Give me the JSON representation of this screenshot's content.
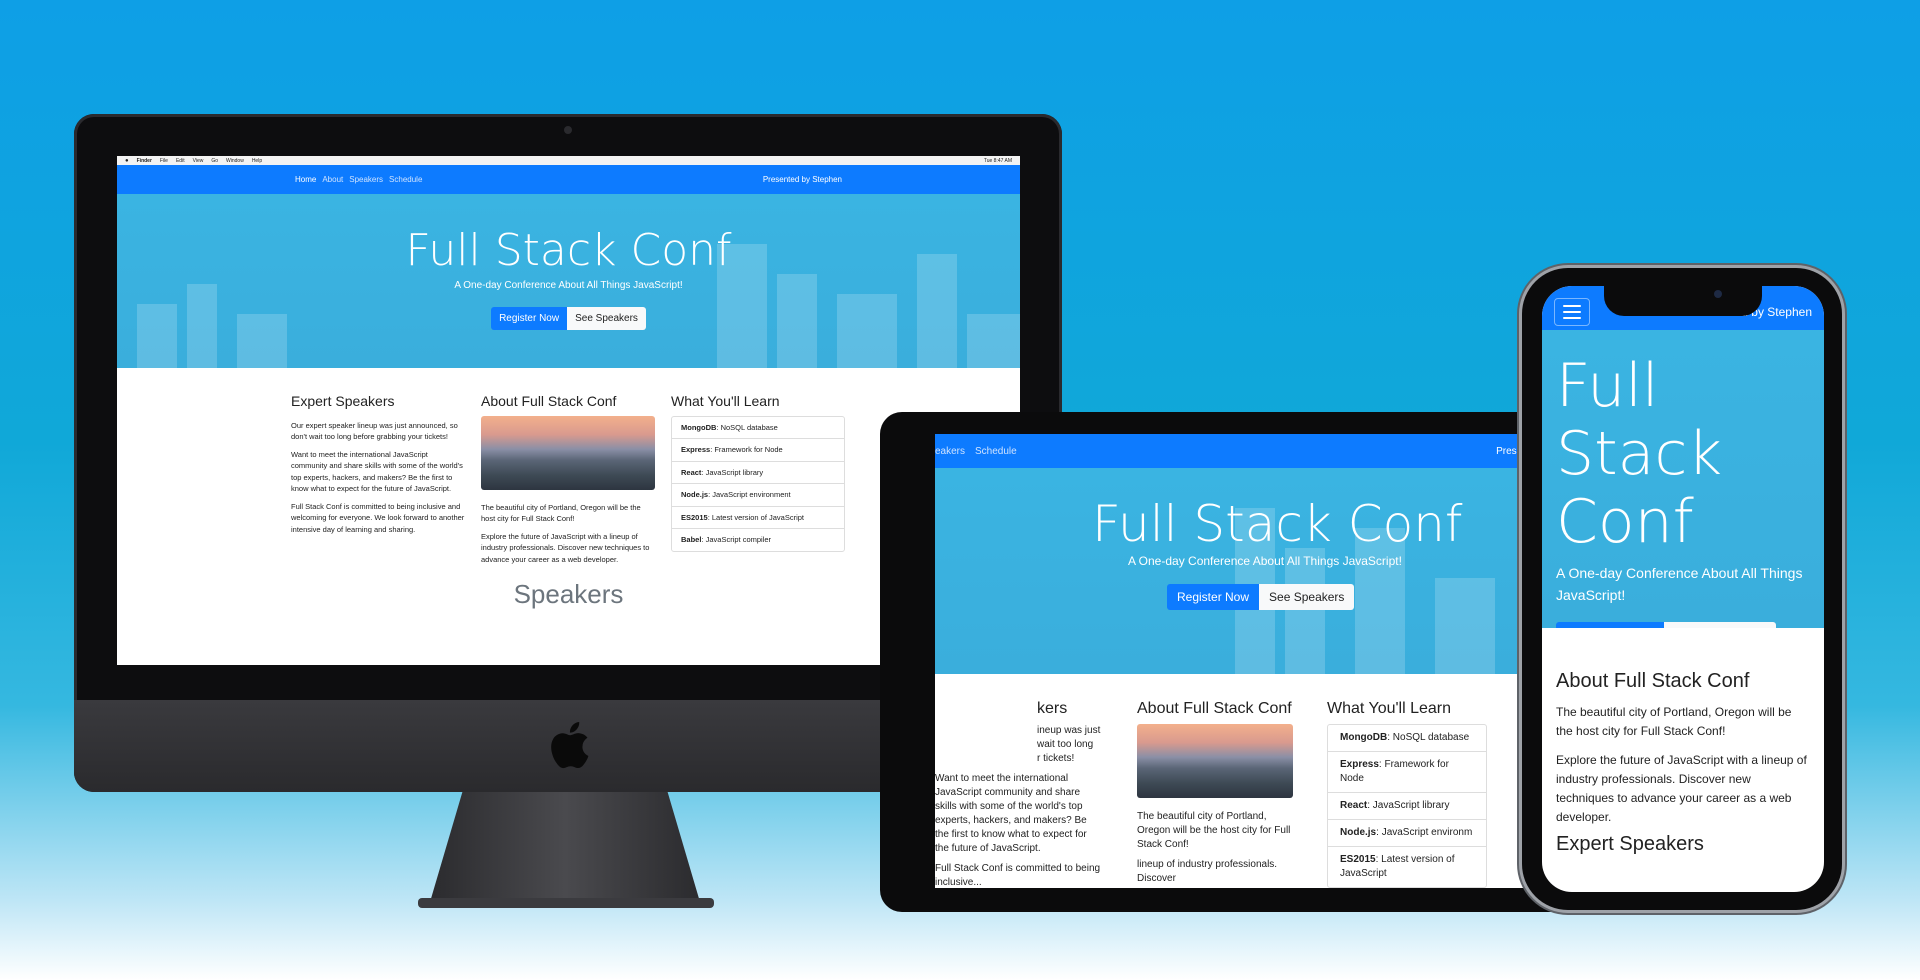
{
  "site": {
    "nav": {
      "home": "Home",
      "about": "About",
      "speakers": "Speakers",
      "schedule": "Schedule",
      "presented_by": "Presented by Stephen"
    },
    "hero": {
      "title": "Full Stack Conf",
      "tagline": "A One-day Conference About All Things JavaScript!",
      "register": "Register Now",
      "see_speakers": "See Speakers"
    },
    "expert": {
      "heading": "Expert Speakers",
      "p1": "Our expert speaker lineup was just announced, so don't wait too long before grabbing your tickets!",
      "p2": "Want to meet the international JavaScript community and share skills with some of the world's top experts, hackers, and makers? Be the first to know what to expect for the future of JavaScript.",
      "p3": "Full Stack Conf is committed to being inclusive and welcoming for everyone. We look forward to another intensive day of learning and sharing."
    },
    "about": {
      "heading": "About Full Stack Conf",
      "p1": "The beautiful city of Portland, Oregon will be the host city for Full Stack Conf!",
      "p2": "Explore the future of JavaScript with a lineup of industry professionals. Discover new techniques to advance your career as a web developer."
    },
    "learn": {
      "heading": "What You'll Learn",
      "items": [
        {
          "name": "MongoDB",
          "desc": ": NoSQL database"
        },
        {
          "name": "Express",
          "desc": ": Framework for Node"
        },
        {
          "name": "React",
          "desc": ": JavaScript library"
        },
        {
          "name": "Node.js",
          "desc": ": JavaScript environment"
        },
        {
          "name": "ES2015",
          "desc": ": Latest version of JavaScript"
        },
        {
          "name": "Babel",
          "desc": ": JavaScript compiler"
        }
      ]
    },
    "speakers_heading": "Speakers"
  },
  "mac_menubar": [
    "Finder",
    "File",
    "Edit",
    "View",
    "Go",
    "Window",
    "Help"
  ],
  "mac_clock": "Tue 8:47 AM",
  "tablet": {
    "nav_speakers": "eakers",
    "nav_presented": "Presented by",
    "expert_heading": "kers",
    "expert_p1_a": "ineup was just",
    "expert_p1_b": "wait too long",
    "expert_p1_c": "r tickets!",
    "learn_node": "JavaScript environm",
    "learn_mongo": "NoSQL database",
    "learn_es": ": Latest version of",
    "learn_es2": "JavaScript",
    "about_p2_cut": "lineup of industry professionals. Discover",
    "inclusive_cut": "Full Stack Conf is committed to being inclusive..."
  },
  "phone": {
    "title_line1": "Full Stack",
    "title_line2": "Conf"
  },
  "colors": {
    "primary": "#0d7bff",
    "hero": "#3ab4e2",
    "background_top": "#0e9fe6"
  }
}
